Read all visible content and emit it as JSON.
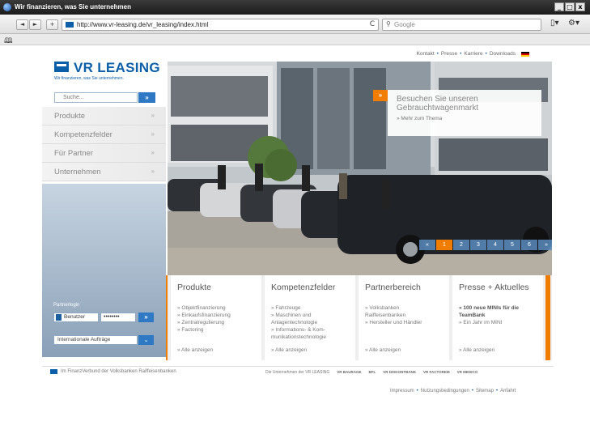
{
  "browser": {
    "title": "Wir finanzieren, was Sie unternehmen",
    "url": "http://www.vr-leasing.de/vr_leasing/index.html",
    "search_placeholder": "Google",
    "win_buttons": [
      "_",
      "□",
      "x"
    ],
    "back": "◄",
    "forward": "►",
    "add": "+",
    "reload": "C"
  },
  "site": {
    "top_nav": [
      "Kontakt",
      "Presse",
      "Karriere",
      "Downloads"
    ],
    "logo_name": "VR LEASING",
    "logo_claim": "Wir finanzieren, was Sie unternehmen.",
    "search_placeholder": "Suche...",
    "search_go": "»",
    "side_nav": [
      {
        "label": "Produkte",
        "arrow": "»"
      },
      {
        "label": "Kompetenzfelder",
        "arrow": "»"
      },
      {
        "label": "Für Partner",
        "arrow": "»"
      },
      {
        "label": "Unternehmen",
        "arrow": "»"
      }
    ],
    "partner_login": {
      "title": "Partnerlogin",
      "user": "Benutzer",
      "password": "••••••••",
      "go": "»"
    },
    "international": "Internationale Aufträge",
    "teaser": {
      "badge": "»",
      "headline_1": "Besuchen Sie unseren",
      "headline_2": "Gebrauchtwagenmarkt",
      "more": "» Mehr zum Thema"
    },
    "pager": [
      "«",
      "1",
      "2",
      "3",
      "4",
      "5",
      "6",
      "»"
    ],
    "boxes": [
      {
        "title": "Produkte",
        "items": [
          "» Objektfinanzierung",
          "» Einkaufsfinanzierung",
          "» Zentralregulierung",
          "» Factoring"
        ],
        "all": "» Alle anzeigen"
      },
      {
        "title": "Kompetenzfelder",
        "items": [
          "» Fahrzeuge",
          "» Maschinen und",
          "   Anlagentechnologie",
          "» Informations- & Kom-",
          "   munikationstechnologie"
        ],
        "all": "» Alle anzeigen"
      },
      {
        "title": "Partnerbereich",
        "items": [
          "» Volksbanken",
          "   Raiffeisenbanken",
          "» Hersteller und Händler"
        ],
        "all": "» Alle anzeigen"
      },
      {
        "title": "Presse + Aktuelles",
        "items": [
          "» 100 neue MINIs für die",
          "   TeamBank",
          "» Ein Jahr im MINI"
        ],
        "all": "» Alle anzeigen"
      }
    ],
    "footer_left": "Im FinanzVerbund der Volksbanken Raiffeisenbanken",
    "footer_companies_label": "Die Unternehmen der VR LEASING",
    "footer_companies": [
      "VR BAURAGE",
      "BFL",
      "VR DISKONTBANK",
      "VR FACTOREM",
      "VR MEDICO"
    ],
    "footer_links": [
      "Impressum",
      "Nutzungsbedingungen",
      "Sitemap",
      "Anfahrt"
    ]
  }
}
